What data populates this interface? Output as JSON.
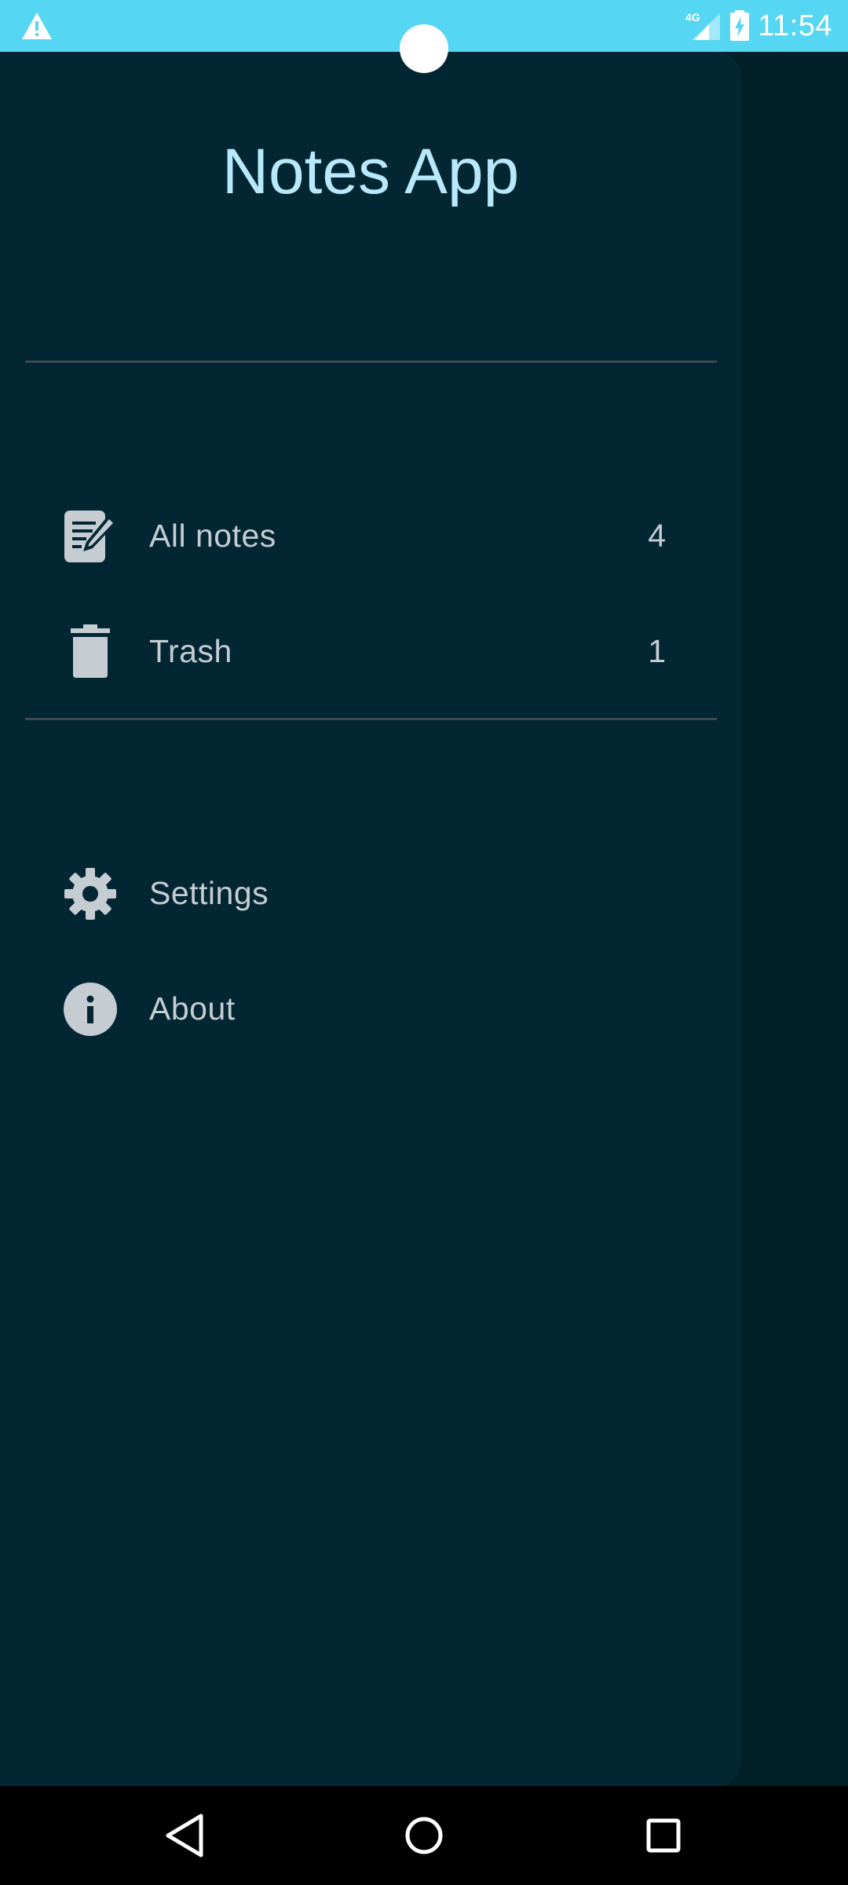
{
  "status_bar": {
    "time": "11:54",
    "network": "4G",
    "background_color": "#55d6f2",
    "icons": [
      "warning-icon",
      "signal-icon",
      "battery-charging-icon"
    ]
  },
  "drawer": {
    "title": "Notes App",
    "title_color": "#b8e9fb",
    "background_color": "#032633",
    "sections": [
      {
        "items": [
          {
            "label": "All notes",
            "count": "4",
            "icon": "edit-note-icon"
          },
          {
            "label": "Trash",
            "count": "1",
            "icon": "trash-icon"
          }
        ]
      },
      {
        "items": [
          {
            "label": "Settings",
            "icon": "gear-icon"
          },
          {
            "label": "About",
            "icon": "info-icon"
          }
        ]
      }
    ]
  },
  "nav_bar": {
    "buttons": [
      "back-icon",
      "home-icon",
      "recents-icon"
    ]
  }
}
